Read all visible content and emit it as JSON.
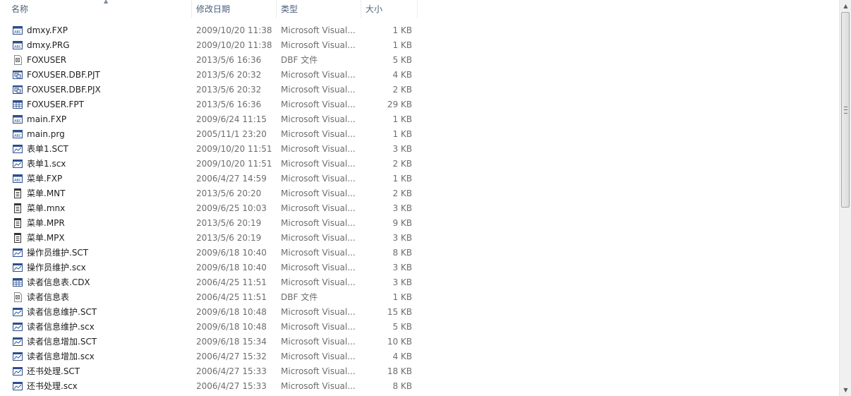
{
  "columns": {
    "name": "名称",
    "date": "修改日期",
    "type": "类型",
    "size": "大小"
  },
  "files": [
    {
      "name": "dmxy.FXP",
      "date": "2009/10/20 11:38",
      "type": "Microsoft Visual...",
      "size": "1 KB",
      "icon": "fxp-file-icon"
    },
    {
      "name": "dmxy.PRG",
      "date": "2009/10/20 11:38",
      "type": "Microsoft Visual...",
      "size": "1 KB",
      "icon": "prg-file-icon"
    },
    {
      "name": "FOXUSER",
      "date": "2013/5/6 16:36",
      "type": "DBF 文件",
      "size": "5 KB",
      "icon": "dbf-file-icon"
    },
    {
      "name": "FOXUSER.DBF.PJT",
      "date": "2013/5/6 20:32",
      "type": "Microsoft Visual...",
      "size": "4 KB",
      "icon": "project-file-icon"
    },
    {
      "name": "FOXUSER.DBF.PJX",
      "date": "2013/5/6 20:32",
      "type": "Microsoft Visual...",
      "size": "2 KB",
      "icon": "project-file-icon"
    },
    {
      "name": "FOXUSER.FPT",
      "date": "2013/5/6 16:36",
      "type": "Microsoft Visual...",
      "size": "29 KB",
      "icon": "table-file-icon"
    },
    {
      "name": "main.FXP",
      "date": "2009/6/24 11:15",
      "type": "Microsoft Visual...",
      "size": "1 KB",
      "icon": "fxp-file-icon"
    },
    {
      "name": "main.prg",
      "date": "2005/11/1 23:20",
      "type": "Microsoft Visual...",
      "size": "1 KB",
      "icon": "prg-file-icon"
    },
    {
      "name": "表单1.SCT",
      "date": "2009/10/20 11:51",
      "type": "Microsoft Visual...",
      "size": "3 KB",
      "icon": "form-file-icon"
    },
    {
      "name": "表单1.scx",
      "date": "2009/10/20 11:51",
      "type": "Microsoft Visual...",
      "size": "2 KB",
      "icon": "form-file-icon"
    },
    {
      "name": "菜单.FXP",
      "date": "2006/4/27 14:59",
      "type": "Microsoft Visual...",
      "size": "1 KB",
      "icon": "fxp-file-icon"
    },
    {
      "name": "菜单.MNT",
      "date": "2013/5/6 20:20",
      "type": "Microsoft Visual...",
      "size": "2 KB",
      "icon": "menu-file-icon"
    },
    {
      "name": "菜单.mnx",
      "date": "2009/6/25 10:03",
      "type": "Microsoft Visual...",
      "size": "3 KB",
      "icon": "menu-file-icon"
    },
    {
      "name": "菜单.MPR",
      "date": "2013/5/6 20:19",
      "type": "Microsoft Visual...",
      "size": "9 KB",
      "icon": "menu-file-icon"
    },
    {
      "name": "菜单.MPX",
      "date": "2013/5/6 20:19",
      "type": "Microsoft Visual...",
      "size": "3 KB",
      "icon": "menu-file-icon"
    },
    {
      "name": "操作员维护.SCT",
      "date": "2009/6/18 10:40",
      "type": "Microsoft Visual...",
      "size": "8 KB",
      "icon": "form-file-icon"
    },
    {
      "name": "操作员维护.scx",
      "date": "2009/6/18 10:40",
      "type": "Microsoft Visual...",
      "size": "3 KB",
      "icon": "form-file-icon"
    },
    {
      "name": "读者信息表.CDX",
      "date": "2006/4/25 11:51",
      "type": "Microsoft Visual...",
      "size": "3 KB",
      "icon": "table-file-icon"
    },
    {
      "name": "读者信息表",
      "date": "2006/4/25 11:51",
      "type": "DBF 文件",
      "size": "1 KB",
      "icon": "dbf-file-icon"
    },
    {
      "name": "读者信息维护.SCT",
      "date": "2009/6/18 10:48",
      "type": "Microsoft Visual...",
      "size": "15 KB",
      "icon": "form-file-icon"
    },
    {
      "name": "读者信息维护.scx",
      "date": "2009/6/18 10:48",
      "type": "Microsoft Visual...",
      "size": "5 KB",
      "icon": "form-file-icon"
    },
    {
      "name": "读者信息增加.SCT",
      "date": "2009/6/18 15:34",
      "type": "Microsoft Visual...",
      "size": "10 KB",
      "icon": "form-file-icon"
    },
    {
      "name": "读者信息增加.scx",
      "date": "2006/4/27 15:32",
      "type": "Microsoft Visual...",
      "size": "4 KB",
      "icon": "form-file-icon"
    },
    {
      "name": "还书处理.SCT",
      "date": "2006/4/27 15:33",
      "type": "Microsoft Visual...",
      "size": "18 KB",
      "icon": "form-file-icon"
    },
    {
      "name": "还书处理.scx",
      "date": "2006/4/27 15:33",
      "type": "Microsoft Visual...",
      "size": "8 KB",
      "icon": "form-file-icon"
    }
  ]
}
